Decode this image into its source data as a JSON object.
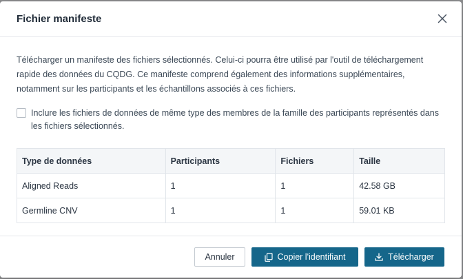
{
  "modal": {
    "title": "Fichier manifeste",
    "description": "Télécharger un manifeste des fichiers sélectionnés. Celui-ci pourra être utilisé par l'outil de téléchargement rapide des données du CQDG. Ce manifeste comprend également des informations supplémentaires, notamment sur les participants et les échantillons associés à ces fichiers.",
    "checkbox_label": "Inclure les fichiers de données de même type des membres de la famille des participants représentés dans les fichiers sélectionnés.",
    "checkbox_checked": false
  },
  "table": {
    "headers": [
      "Type de données",
      "Participants",
      "Fichiers",
      "Taille"
    ],
    "rows": [
      [
        "Aligned Reads",
        "1",
        "1",
        "42.58 GB"
      ],
      [
        "Germline CNV",
        "1",
        "1",
        "59.01 KB"
      ]
    ]
  },
  "footer": {
    "cancel_label": "Annuler",
    "copy_label": "Copier l'identifiant",
    "download_label": "Télécharger"
  },
  "colors": {
    "primary": "#15668a",
    "border": "#e1e5ea",
    "header_bg": "#f4f6f8"
  },
  "icons": {
    "close": "close-icon",
    "copy": "copy-icon",
    "download": "download-icon"
  }
}
